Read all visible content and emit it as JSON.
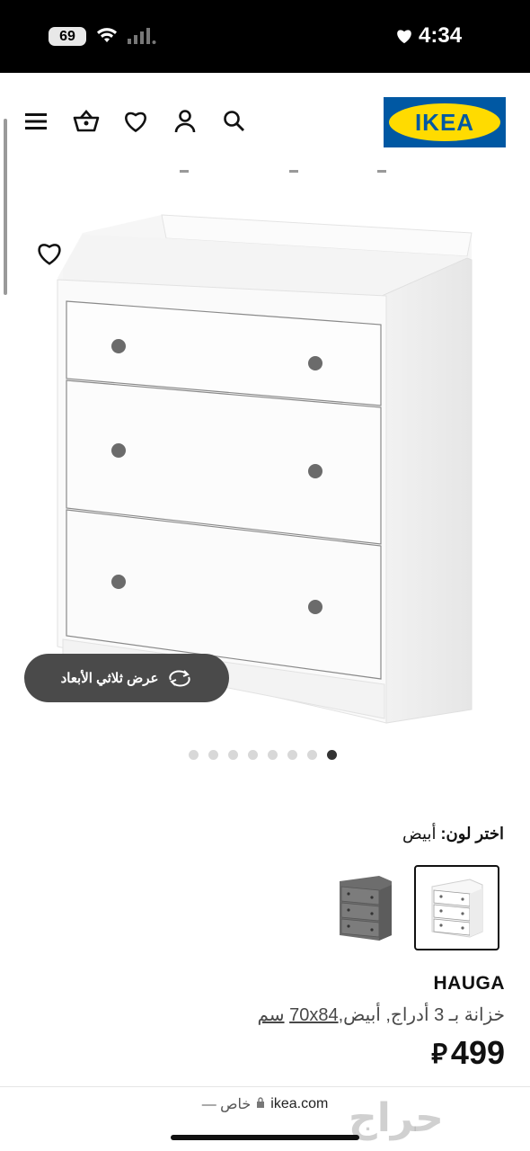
{
  "status_bar": {
    "battery": "69",
    "time": "4:34"
  },
  "header": {
    "logo_text": "IKEA",
    "icons": [
      "menu-icon",
      "basket-icon",
      "heart-icon",
      "user-icon",
      "search-icon"
    ]
  },
  "product_view": {
    "button_3d_label": "عرض ثلاثي الأبعاد",
    "dots_total": 8,
    "dots_active_index": 7
  },
  "color_picker": {
    "label": "اختر لون:",
    "selected_value": "أبيض"
  },
  "product": {
    "name": "HAUGA",
    "description_prefix": "خزانة بـ 3 أدراج, أبيض,",
    "description_size": "70x84",
    "description_unit": "سم",
    "price": "499",
    "currency_symbol": "⃁"
  },
  "url_bar": {
    "host": "ikea.com",
    "mode": "— خاص"
  },
  "watermark": "حراج",
  "colors": {
    "ikea_blue": "#0058a3",
    "ikea_yellow": "#ffdb00",
    "pill": "#4a4a4a"
  }
}
